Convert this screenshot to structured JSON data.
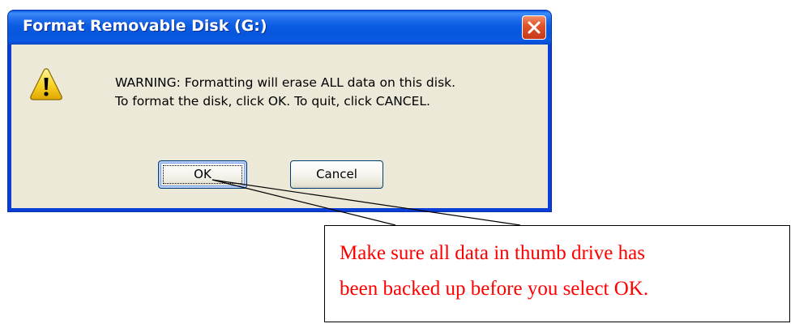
{
  "dialog": {
    "title": "Format Removable Disk (G:)",
    "icon": "warning-icon",
    "message_lines": [
      "WARNING: Formatting will erase ALL data on this disk.",
      "To format the disk, click OK. To quit, click CANCEL."
    ],
    "buttons": {
      "ok_label": "OK",
      "cancel_label": "Cancel"
    },
    "close_icon": "close-icon"
  },
  "callout": {
    "lines": [
      "Make sure all data in thumb drive has",
      "been backed up before you select OK."
    ],
    "text_color": "#ff0000"
  },
  "colors": {
    "titlebar": "#0a5ae8",
    "client": "#ece9d8",
    "close_button": "#e2542c"
  }
}
